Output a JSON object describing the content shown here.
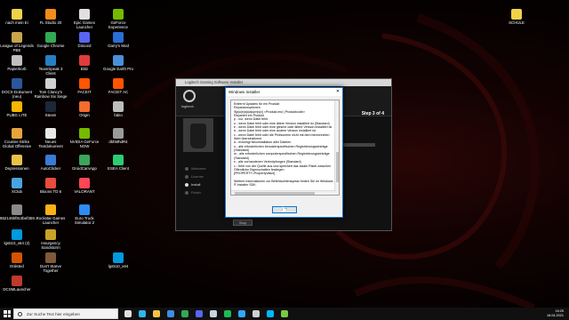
{
  "desktop": {
    "icons": [
      {
        "label": "nach mein Ei",
        "color": "#f0d24a"
      },
      {
        "label": "FL Studio 20",
        "color": "#f28c1a"
      },
      {
        "label": "Epic Games Launcher",
        "color": "#e0e0e0"
      },
      {
        "label": "GeForce Experience",
        "color": "#76b900"
      },
      {
        "label": "League of Legends PBE",
        "color": "#c8a54a"
      },
      {
        "label": "Google Chrome",
        "color": "#34a853"
      },
      {
        "label": "Discord",
        "color": "#5865f2"
      },
      {
        "label": "Garry's Mod",
        "color": "#2a6fd6"
      },
      {
        "label": "Papierkorb",
        "color": "#c0c0c0"
      },
      {
        "label": "TeamSpeak 3 Client",
        "color": "#2580c3"
      },
      {
        "label": "Blitz",
        "color": "#e23b3b"
      },
      {
        "label": "Google Earth Pro",
        "color": "#4a90d9"
      },
      {
        "label": "DOCX-Dokument (neu)",
        "color": "#2b579a"
      },
      {
        "label": "Tom Clancy's Rainbow Six Siege",
        "color": "#d0d0d0"
      },
      {
        "label": "FACEIT",
        "color": "#ff5500"
      },
      {
        "label": "FACEIT AC",
        "color": "#ff5500"
      },
      {
        "label": "PUBG LITE",
        "color": "#f5b700"
      },
      {
        "label": "Steam",
        "color": "#1b2838"
      },
      {
        "label": "Origin",
        "color": "#f56c2d"
      },
      {
        "label": "fabio",
        "color": "#bdbdbd"
      },
      {
        "label": "Counter-Strike Global Offensive",
        "color": "#e8a33c"
      },
      {
        "label": "Neues Textdokument",
        "color": "#e8e8e8"
      },
      {
        "label": "NVIDIA GeForce NOW",
        "color": "#76b900"
      },
      {
        "label": "dkhMhdR4",
        "color": "#9a9a9a"
      },
      {
        "label": "Depressionen",
        "color": "#e8c14a"
      },
      {
        "label": "AutoClicker",
        "color": "#3a7bd5"
      },
      {
        "label": "DroidCamApp",
        "color": "#3ba55c"
      },
      {
        "label": "ESEA Client",
        "color": "#2ecc71"
      },
      {
        "label": "XClub",
        "color": "#4aa3df"
      },
      {
        "label": "Bloons TD 6",
        "color": "#e74c3c"
      },
      {
        "label": "VALORANT",
        "color": "#ff4655"
      },
      {
        "label": "862146bf8c3bef359...",
        "color": "#8a8a8a"
      },
      {
        "label": "Rockstar Games Launcher",
        "color": "#fcaf17"
      },
      {
        "label": "Euro Truck Simulator 2",
        "color": "#2c8cf4"
      },
      {
        "label": "lgs510_x64 (2)",
        "color": "#0099dd"
      },
      {
        "label": "Insurgency Sandstorm",
        "color": "#c9a227"
      },
      {
        "label": "Enlisted",
        "color": "#d35400"
      },
      {
        "label": "Don't Starve Together",
        "color": "#7f5a3a"
      },
      {
        "label": "lgs510_x64",
        "color": "#0099dd"
      },
      {
        "label": "DCSMLauncher",
        "color": "#c0392b"
      },
      {
        "label": "SCHULE",
        "color": "#f0d24a"
      }
    ]
  },
  "logitech": {
    "title": "Logitech Gaming Software Installer",
    "brand": "logitech",
    "step": "Step 3 of 4",
    "steps": [
      {
        "label": "Welcome",
        "active": false
      },
      {
        "label": "License",
        "active": false
      },
      {
        "label": "Install",
        "active": true
      },
      {
        "label": "Finish",
        "active": false
      }
    ],
    "stop_label": "Stop"
  },
  "installer_dialog": {
    "title": "Windows Installer",
    "close_glyph": "✕",
    "body": "Entfernt Updates für ein Produkt\nReparaturoptionen\n/f[p|o|e|d|c|a|u|m|s|v] <Produkt.msi | Produktcode>\n  Repariert ein Produkt\n  p - nur, wenn Datei fehlt\n  o - wenn Datei fehlt oder eine ältere Version installiert ist (Standard)\n  e - wenn Datei fehlt oder eine gleiche oder ältere Version installiert ist\n  d - wenn Datei fehlt oder eine andere Version installiert ist\n  c - wenn Datei fehlt oder die Prüfsumme nicht mit dem berechneten Wert übereinstimmt\n  a - erzwingt Neuinstallation aller Dateien\n  u - alle erforderlichen benutzerspezifischen Registrierungseinträge (Standard)\n  m - alle erforderlichen computerspezifischen Registrierungseinträge (Standard)\n  s - alle vorhandenen Verknüpfungen (Standard)\n  v - führt von der Quelle aus und speichert das lokale Paket zwischen\nÖffentliche Eigenschaften festlegen\n  [PROPERTY=PropertyValue]\n\nWeitere Informationen zur Befehlszeilensyntax finden Sie im Windows ® Installer SDK.\n\nCopyright © Microsoft Corporation. Alle Rechte vorbehalten.\nTeile dieser Software basieren zum Teil auf der Arbeit der Independent JPEG Group.",
    "ok_label": "OK"
  },
  "taskbar": {
    "search_placeholder": "Zur Suche Text hier eingeben",
    "apps": [
      {
        "name": "task-view-icon",
        "color": "#e0e0e0"
      },
      {
        "name": "edge-icon",
        "color": "#2fb5e8"
      },
      {
        "name": "file-explorer-icon",
        "color": "#f5c342"
      },
      {
        "name": "store-icon",
        "color": "#3a8ee6"
      },
      {
        "name": "chrome-icon",
        "color": "#34a853"
      },
      {
        "name": "discord-icon",
        "color": "#5865f2"
      },
      {
        "name": "steam-icon",
        "color": "#c7d5e0"
      },
      {
        "name": "spotify-icon",
        "color": "#1db954"
      },
      {
        "name": "photoshop-icon",
        "color": "#31a8ff"
      },
      {
        "name": "app-icon",
        "color": "#d0d0d0"
      },
      {
        "name": "logitech-icon",
        "color": "#00b8fc"
      },
      {
        "name": "installer-icon",
        "color": "#7ac943"
      }
    ],
    "time": "16:25",
    "date": "18.04.2021"
  }
}
